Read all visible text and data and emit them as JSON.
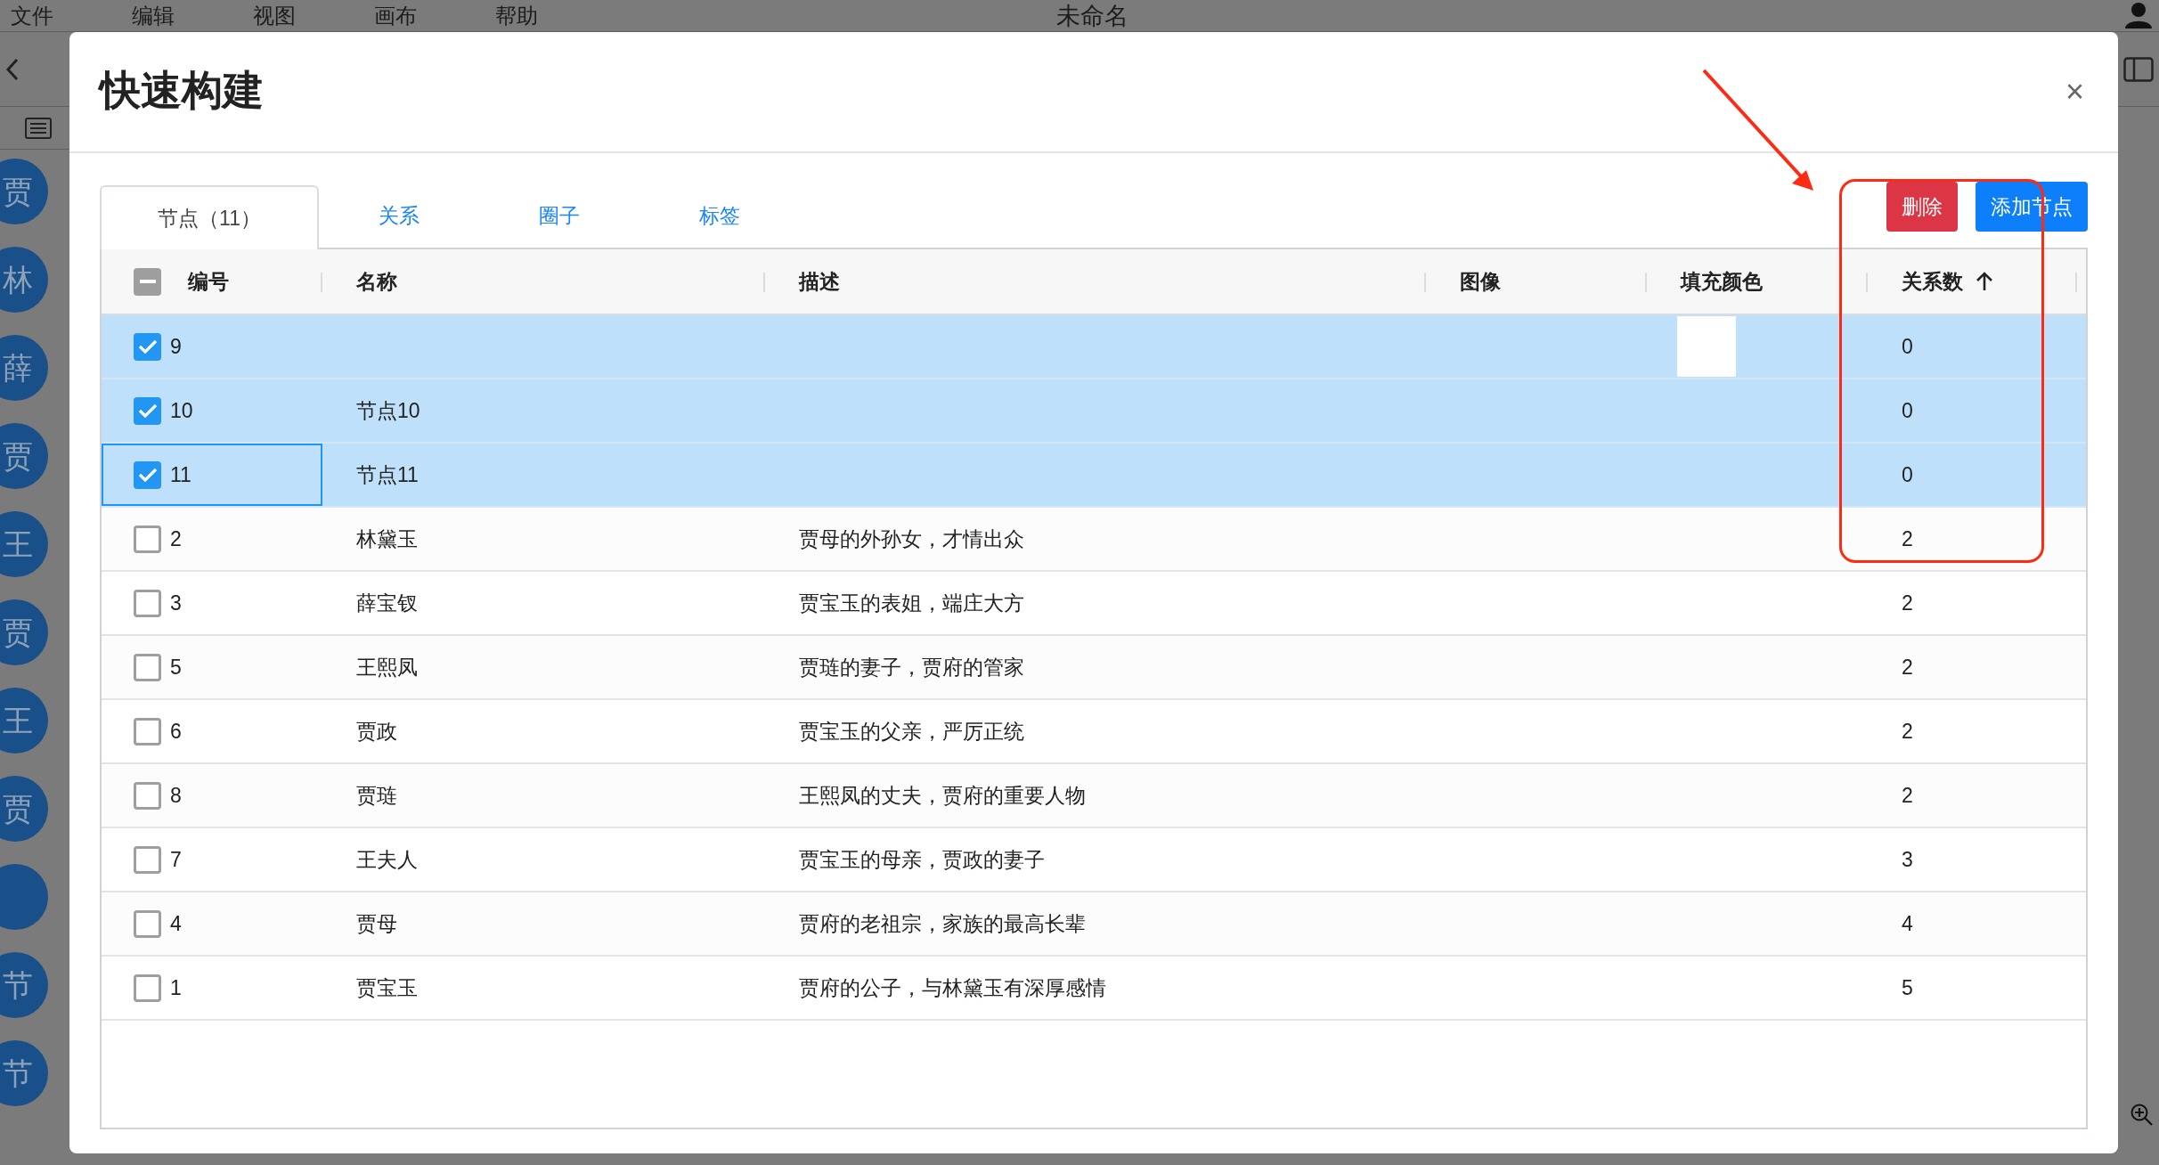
{
  "menu_bar": {
    "items": [
      "文件",
      "编辑",
      "视图",
      "画布",
      "帮助"
    ],
    "title": "未命名"
  },
  "sidebar": {
    "nodes": [
      {
        "kind": "letter",
        "label": "贾"
      },
      {
        "kind": "letter",
        "label": "林"
      },
      {
        "kind": "letter",
        "label": "薛"
      },
      {
        "kind": "letter",
        "label": "贾"
      },
      {
        "kind": "letter",
        "label": "王"
      },
      {
        "kind": "letter",
        "label": "贾"
      },
      {
        "kind": "letter",
        "label": "王"
      },
      {
        "kind": "letter",
        "label": "贾"
      },
      {
        "kind": "blank"
      },
      {
        "kind": "letter",
        "label": "节"
      },
      {
        "kind": "letter",
        "label": "节"
      }
    ]
  },
  "dialog": {
    "title": "快速构建",
    "close": "×",
    "tabs": [
      {
        "label": "节点（11）",
        "selected": true
      },
      {
        "label": "关系",
        "selected": false
      },
      {
        "label": "圈子",
        "selected": false
      },
      {
        "label": "标签",
        "selected": false
      }
    ],
    "buttons": [
      {
        "label": "删除",
        "kind": "danger"
      },
      {
        "label": "添加节点",
        "kind": "primary"
      }
    ],
    "table": {
      "select_all": {
        "indeterminate": true
      },
      "columns": [
        {
          "label": "编号",
          "sorted": false
        },
        {
          "label": "名称",
          "sorted": false
        },
        {
          "label": "描述",
          "sorted": false
        },
        {
          "label": "图像",
          "sorted": false
        },
        {
          "label": "填充颜色",
          "sorted": false
        },
        {
          "label": "关系数",
          "sorted": true
        }
      ],
      "rows": [
        {
          "selected": true,
          "focused": false,
          "id": "9",
          "color": "#ffffff",
          "relations": "0"
        },
        {
          "selected": true,
          "focused": false,
          "id": "10",
          "name": "节点10",
          "relations": "0"
        },
        {
          "selected": true,
          "focused": true,
          "id": "11",
          "name": "节点11",
          "relations": "0"
        },
        {
          "selected": false,
          "focused": false,
          "id": "2",
          "name": "林黛玉",
          "description": "贾母的外孙女，才情出众",
          "relations": "2"
        },
        {
          "selected": false,
          "focused": false,
          "id": "3",
          "name": "薛宝钗",
          "description": "贾宝玉的表姐，端庄大方",
          "relations": "2"
        },
        {
          "selected": false,
          "focused": false,
          "id": "5",
          "name": "王熙凤",
          "description": "贾琏的妻子，贾府的管家",
          "relations": "2"
        },
        {
          "selected": false,
          "focused": false,
          "id": "6",
          "name": "贾政",
          "description": "贾宝玉的父亲，严厉正统",
          "relations": "2"
        },
        {
          "selected": false,
          "focused": false,
          "id": "8",
          "name": "贾琏",
          "description": "王熙凤的丈夫，贾府的重要人物",
          "relations": "2"
        },
        {
          "selected": false,
          "focused": false,
          "id": "7",
          "name": "王夫人",
          "description": "贾宝玉的母亲，贾政的妻子",
          "relations": "3"
        },
        {
          "selected": false,
          "focused": false,
          "id": "4",
          "name": "贾母",
          "description": "贾府的老祖宗，家族的最高长辈",
          "relations": "4"
        },
        {
          "selected": false,
          "focused": false,
          "id": "1",
          "name": "贾宝玉",
          "description": "贾府的公子，与林黛玉有深厚感情",
          "relations": "5"
        }
      ]
    }
  }
}
